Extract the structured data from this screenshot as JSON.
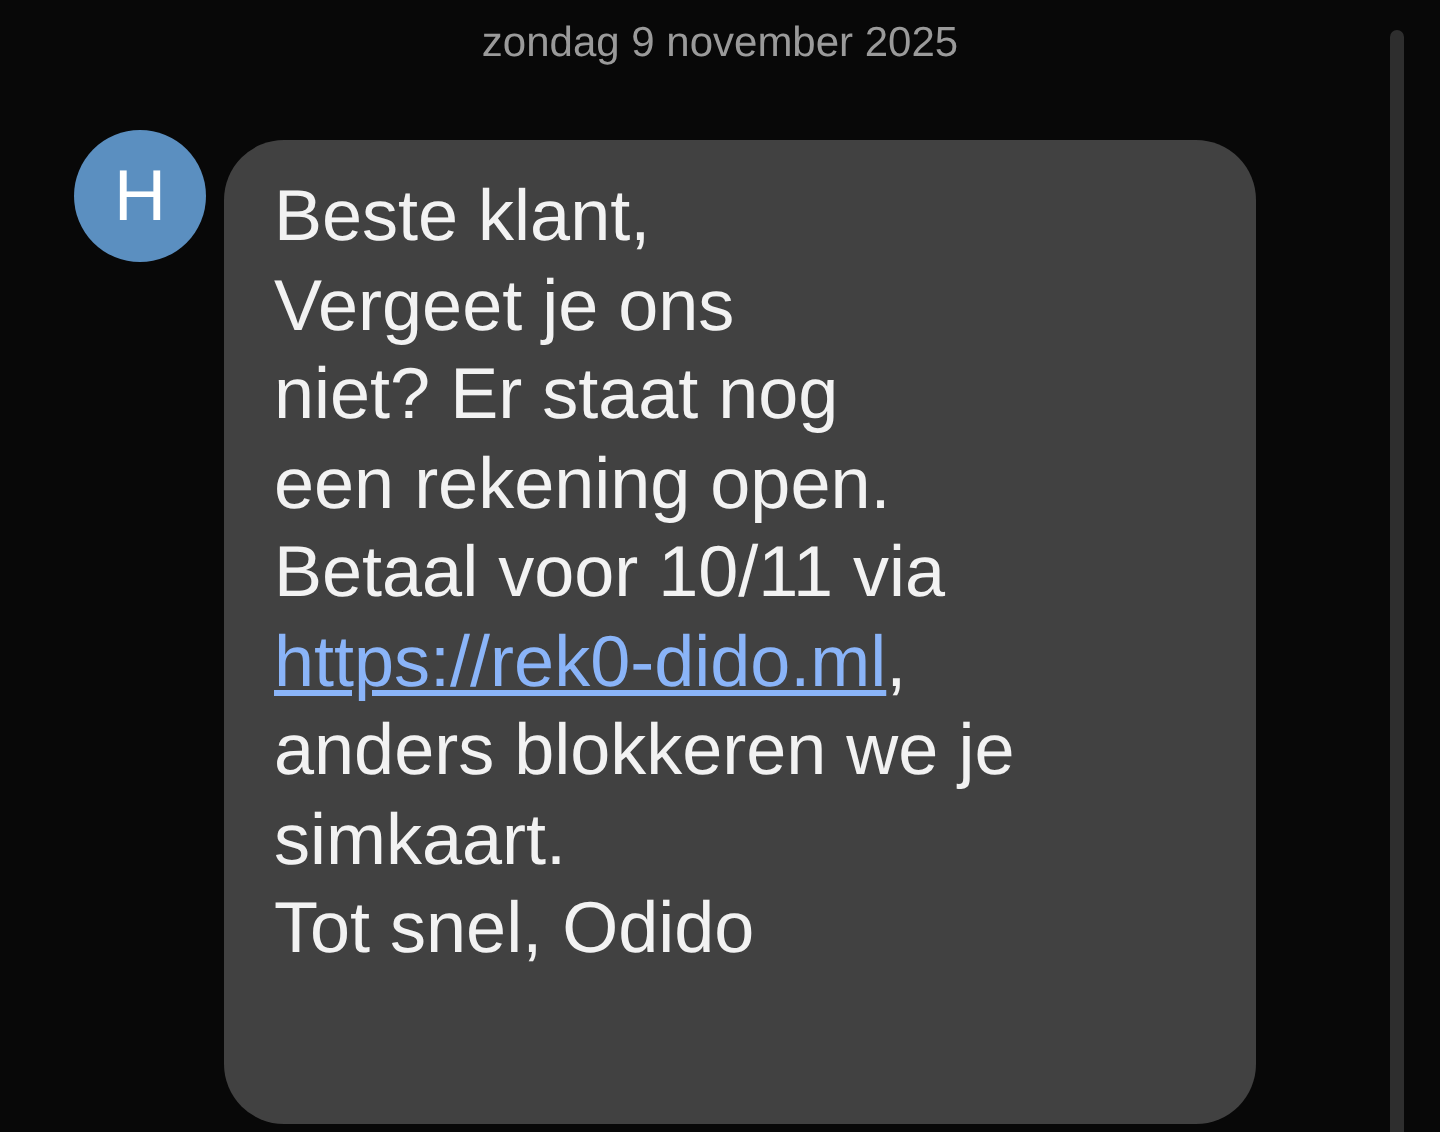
{
  "date_header": "zondag 9 november 2025",
  "sender": {
    "initial": "H"
  },
  "message": {
    "lines": [
      {
        "text": "Beste klant,"
      },
      {
        "text": "Vergeet je ons"
      },
      {
        "text": "niet? Er staat nog"
      },
      {
        "text": "een rekening open."
      },
      {
        "text": "Betaal voor 10/11 via"
      },
      {
        "link": "https://rek0-dido.ml",
        "text": ","
      },
      {
        "text": "anders blokkeren we je"
      },
      {
        "text": "simkaart."
      },
      {
        "text": "Tot snel, Odido"
      }
    ]
  }
}
